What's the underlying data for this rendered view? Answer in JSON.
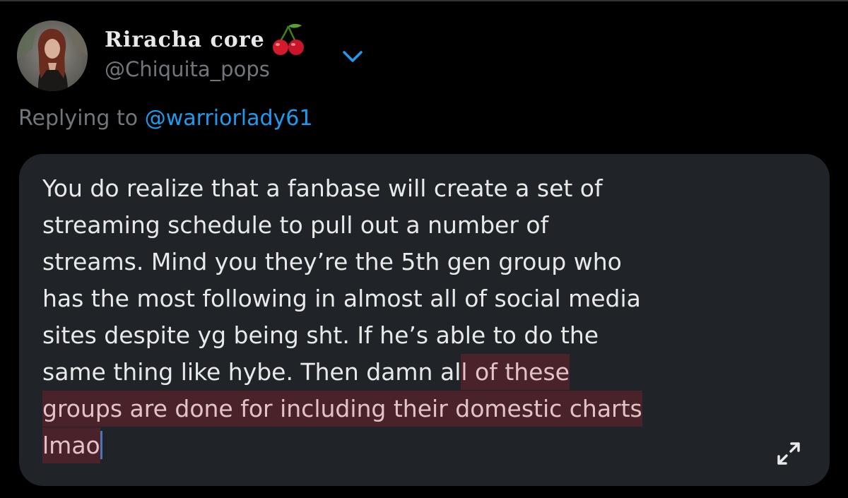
{
  "tweet": {
    "display_name": "Riracha core",
    "handle": "@Chiquita_pops",
    "name_emoji_icon": "cherry-icon",
    "menu_icon": "chevron-down-icon",
    "replying_prefix": "Replying to",
    "replying_mention": "@warriorlady61",
    "message": {
      "line1": "You do realize that a fanbase will create a set of",
      "line2": "streaming schedule to pull out a number of",
      "line3": "streams. Mind you they’re the 5th gen group who",
      "line4": "has the most following in almost all of social media",
      "line5": "sites despite yg being sht. If he’s able to do the",
      "line6_plain": "same thing like hybe. Then damn al",
      "line6_highlight": "l of these",
      "line7_highlight": "groups are done for including their domestic charts",
      "line8_highlight": "lmao"
    },
    "expand_icon": "expand-icon"
  },
  "colors": {
    "background": "#000000",
    "bubble": "#202327",
    "text_primary": "#e7e9ea",
    "text_secondary": "#71767b",
    "accent_blue": "#1d9bf0",
    "highlight_bg": "#4a2229",
    "highlight_text": "#e2c3c8"
  }
}
